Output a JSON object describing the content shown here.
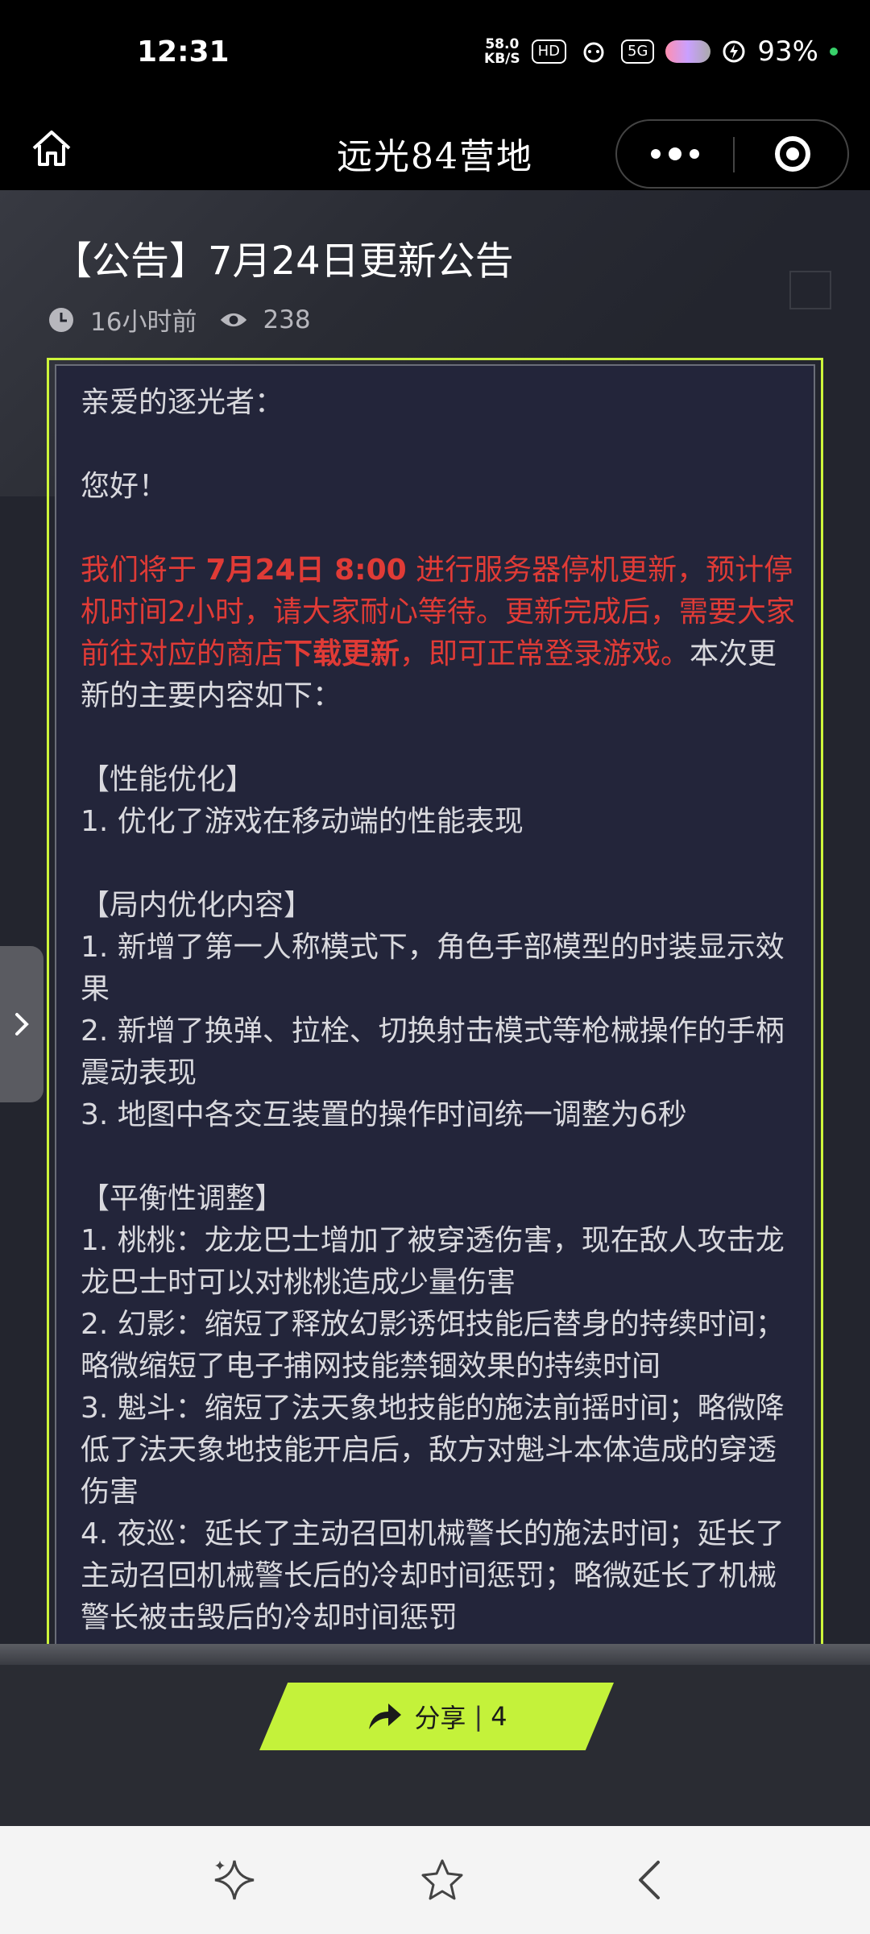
{
  "status_bar": {
    "time": "12:31",
    "net_speed_value": "58.0",
    "net_speed_unit": "KB/S",
    "hd_label": "HD",
    "signal_label": "5G",
    "battery_pct": "93%"
  },
  "title_bar": {
    "title": "远光84营地"
  },
  "post": {
    "title": "【公告】7月24日更新公告",
    "time_ago": "16小时前",
    "views": "238"
  },
  "content": {
    "greeting": "亲爱的逐光者：",
    "hello": "您好！",
    "notice_red_1": "我们将于 ",
    "notice_red_date": "7月24日 8:00",
    "notice_red_2": " 进行服务器停机更新，预计停机时间2小时，请大家耐心等待。更新完成后，需要大家前往对应的商店",
    "notice_red_bold": "下载更新",
    "notice_red_3": "，即可正常登录游戏。",
    "notice_tail": "本次更新的主要内容如下：",
    "section1_title": "【性能优化】",
    "section1_item1": "1. 优化了游戏在移动端的性能表现",
    "section2_title": "【局内优化内容】",
    "section2_item1": "1. 新增了第一人称模式下，角色手部模型的时装显示效果",
    "section2_item2": "2. 新增了换弹、拉栓、切换射击模式等枪械操作的手柄震动表现",
    "section2_item3": "3. 地图中各交互装置的操作时间统一调整为6秒",
    "section3_title": "【平衡性调整】",
    "section3_item1": "1. 桃桃：龙龙巴士增加了被穿透伤害，现在敌人攻击龙龙巴士时可以对桃桃造成少量伤害",
    "section3_item2": "2. 幻影：缩短了释放幻影诱饵技能后替身的持续时间；略微缩短了电子捕网技能禁锢效果的持续时间",
    "section3_item3": "3. 魁斗：缩短了法天象地技能的施法前摇时间；略微降低了法天象地技能开启后，敌方对魁斗本体造成的穿透伤害",
    "section3_item4": "4. 夜巡：延长了主动召回机械警长的施法时间；延长了主动召回机械警长后的冷却时间惩罚；略微延长了机械警长被击毁后的冷却时间惩罚"
  },
  "share": {
    "label": "分享",
    "divider": "|",
    "count": "4"
  },
  "colors": {
    "accent": "#cdf53a",
    "notice_red": "#e03b36"
  }
}
